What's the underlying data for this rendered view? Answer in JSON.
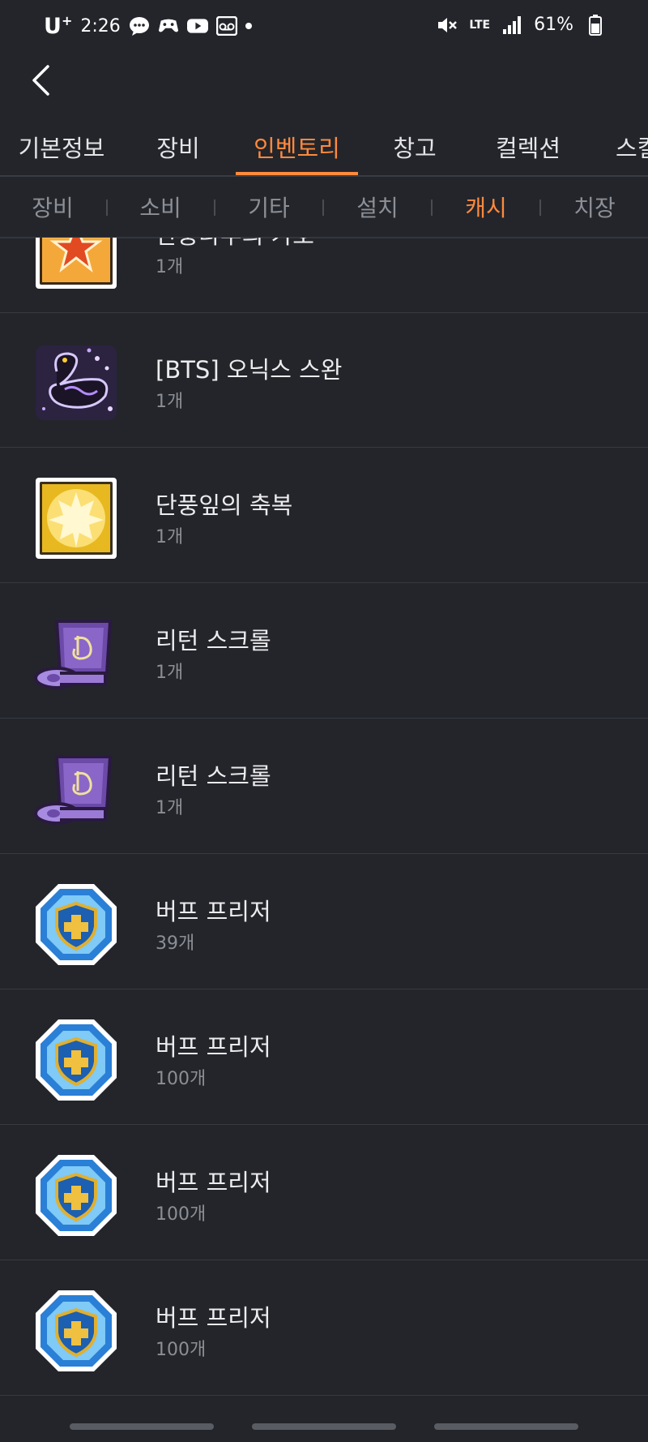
{
  "status_bar": {
    "carrier": "U",
    "carrier_sup": "+",
    "time": "2:26",
    "network": "LTE",
    "battery": "61%"
  },
  "header": {
    "back_icon": "chevron-left-icon"
  },
  "main_tabs": [
    "기본정보",
    "장비",
    "인벤토리",
    "창고",
    "컬렉션",
    "스킬"
  ],
  "main_tab_active": "인벤토리",
  "sub_tabs": [
    "장비",
    "소비",
    "기타",
    "설치",
    "캐시",
    "치장"
  ],
  "sub_tab_active": "캐시",
  "items": [
    {
      "name": "단풍나무의 가호",
      "count": "1개",
      "icon": "maple-tree-blessing-icon"
    },
    {
      "name": "[BTS] 오닉스 스완",
      "count": "1개",
      "icon": "onyx-swan-icon"
    },
    {
      "name": "단풍잎의 축복",
      "count": "1개",
      "icon": "maple-leaf-blessing-icon"
    },
    {
      "name": "리턴 스크롤",
      "count": "1개",
      "icon": "return-scroll-icon"
    },
    {
      "name": "리턴 스크롤",
      "count": "1개",
      "icon": "return-scroll-icon"
    },
    {
      "name": "버프 프리저",
      "count": "39개",
      "icon": "buff-freezer-icon"
    },
    {
      "name": "버프 프리저",
      "count": "100개",
      "icon": "buff-freezer-icon"
    },
    {
      "name": "버프 프리저",
      "count": "100개",
      "icon": "buff-freezer-icon"
    },
    {
      "name": "버프 프리저",
      "count": "100개",
      "icon": "buff-freezer-icon"
    }
  ],
  "colors": {
    "background": "#23252b",
    "accent": "#ff8a3d",
    "text_primary": "#ececee",
    "text_secondary": "#8c8e95",
    "divider": "#383a41"
  }
}
